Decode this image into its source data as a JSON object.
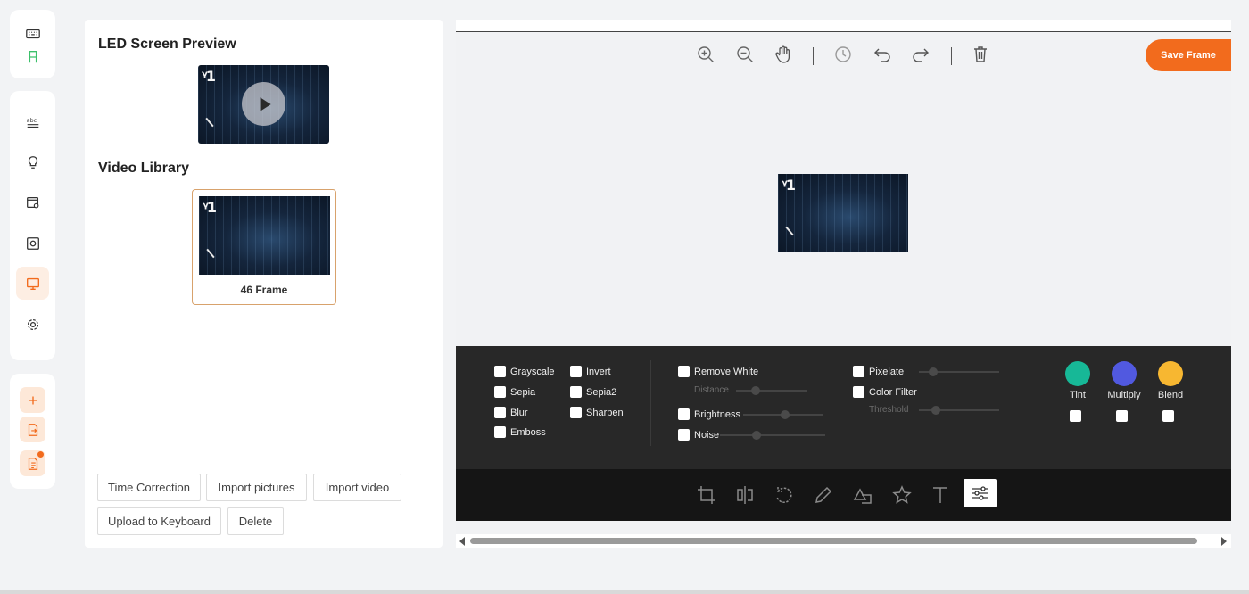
{
  "rail": {
    "top_items": [
      "keyboard-icon",
      "chair-icon"
    ],
    "middle_items": [
      "text-abc-icon",
      "bulb-icon",
      "browser-settings-icon",
      "settings-panel-icon",
      "monitor-icon",
      "gear-icon"
    ],
    "active_item": "monitor-icon",
    "bottom_items": [
      "plus-icon",
      "file-import-icon",
      "file-doc-icon"
    ]
  },
  "left_panel": {
    "preview_title": "LED Screen Preview",
    "library_title": "Video Library",
    "library_items": [
      {
        "label": "46 Frame"
      }
    ],
    "buttons": {
      "time_correction": "Time Correction",
      "import_pictures": "Import pictures",
      "import_video": "Import video",
      "upload_keyboard": "Upload to Keyboard",
      "delete": "Delete"
    }
  },
  "editor": {
    "toolbar": [
      "zoom-in-icon",
      "zoom-out-icon",
      "hand-icon",
      "history-icon",
      "undo-icon",
      "redo-icon",
      "trash-icon"
    ],
    "save_label": "Save Frame",
    "filters": {
      "col1": [
        "Grayscale",
        "Sepia",
        "Blur",
        "Emboss"
      ],
      "col2": [
        "Invert",
        "Sepia2",
        "Sharpen"
      ],
      "remove_white": "Remove White",
      "distance": "Distance",
      "brightness": "Brightness",
      "noise": "Noise",
      "pixelate": "Pixelate",
      "color_filter": "Color Filter",
      "threshold": "Threshold",
      "blend_modes": [
        {
          "label": "Tint",
          "color": "#17b897"
        },
        {
          "label": "Multiply",
          "color": "#5159e0"
        },
        {
          "label": "Blend",
          "color": "#f7b731"
        }
      ]
    },
    "bottom_tools": [
      "crop-icon",
      "flip-icon",
      "rotate-icon",
      "draw-icon",
      "shape-icon",
      "star-icon",
      "text-icon",
      "filter-sliders-icon"
    ],
    "active_bottom_tool": "filter-sliders-icon"
  },
  "colors": {
    "accent": "#f26b1d",
    "dark_panel": "#282828"
  }
}
